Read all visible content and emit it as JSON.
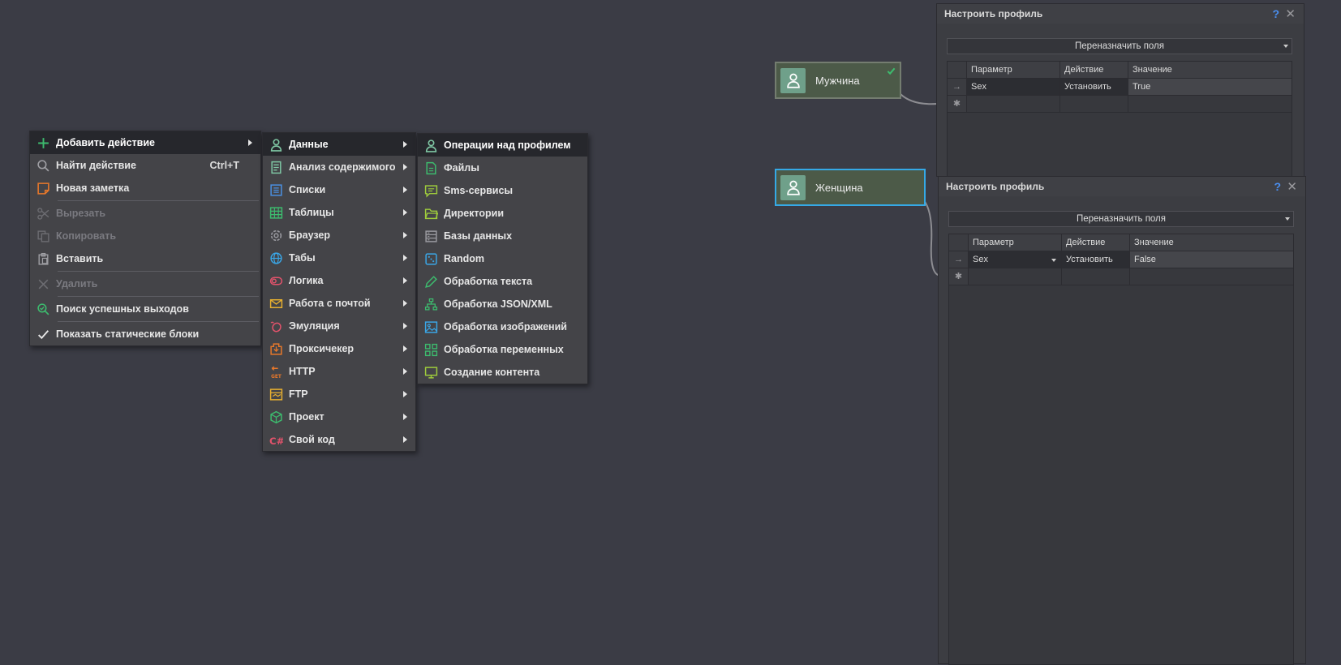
{
  "menu_main": {
    "items": [
      {
        "label": "Добавить действие",
        "icon": "plus-icon",
        "color": "#3dbb6e",
        "active": true,
        "arrow": true,
        "disabled": false
      },
      {
        "label": "Найти действие",
        "icon": "search-icon",
        "shortcut": "Ctrl+T",
        "disabled": false
      },
      {
        "label": "Новая заметка",
        "icon": "note-icon",
        "color": "#e8782a",
        "disabled": false
      },
      {
        "label": "Вырезать",
        "icon": "scissors-icon",
        "disabled": true
      },
      {
        "label": "Копировать",
        "icon": "copy-icon",
        "disabled": true
      },
      {
        "label": "Вставить",
        "icon": "paste-icon",
        "disabled": false
      },
      {
        "label": "Удалить",
        "icon": "close-icon",
        "disabled": true
      },
      {
        "label": "Поиск успешных выходов",
        "icon": "search-check-icon",
        "color": "#3dbb6e",
        "disabled": false
      },
      {
        "label": "Показать статические блоки",
        "icon": "check-icon",
        "disabled": false
      }
    ]
  },
  "menu_categories": {
    "items": [
      {
        "label": "Данные",
        "icon": "user-icon",
        "color": "#7fc7a4",
        "active": true
      },
      {
        "label": "Анализ содержимого",
        "icon": "document-analysis-icon",
        "color": "#7fc7a4"
      },
      {
        "label": "Списки",
        "icon": "list-icon",
        "color": "#4a90e2"
      },
      {
        "label": "Таблицы",
        "icon": "table-icon",
        "color": "#3dbb6e"
      },
      {
        "label": "Браузер",
        "icon": "gear-icon",
        "color": "#9a9aa0"
      },
      {
        "label": "Табы",
        "icon": "globe-icon",
        "color": "#3aa6e6"
      },
      {
        "label": "Логика",
        "icon": "toggle-icon",
        "color": "#e5536c"
      },
      {
        "label": "Работа с почтой",
        "icon": "mail-icon",
        "color": "#e8b030"
      },
      {
        "label": "Эмуляция",
        "icon": "mouse-icon",
        "color": "#e5536c"
      },
      {
        "label": "Проксичекер",
        "icon": "proxy-icon",
        "color": "#e8782a"
      },
      {
        "label": "HTTP",
        "icon": "http-get-icon",
        "color": "#e8782a"
      },
      {
        "label": "FTP",
        "icon": "ftp-icon",
        "color": "#e8b030"
      },
      {
        "label": "Проект",
        "icon": "cube-icon",
        "color": "#3dbb6e"
      },
      {
        "label": "Свой код",
        "icon": "csharp-icon",
        "color": "#e5536c"
      }
    ]
  },
  "menu_data": {
    "items": [
      {
        "label": "Операции над профилем",
        "icon": "user-icon",
        "color": "#7fc7a4",
        "active": true
      },
      {
        "label": "Файлы",
        "icon": "file-icon",
        "color": "#3dbb6e"
      },
      {
        "label": "Sms-сервисы",
        "icon": "chat-icon",
        "color": "#9ecb3c"
      },
      {
        "label": "Директории",
        "icon": "folder-icon",
        "color": "#9ecb3c"
      },
      {
        "label": "Базы данных",
        "icon": "database-icon",
        "color": "#9a9aa0"
      },
      {
        "label": "Random",
        "icon": "dice-icon",
        "color": "#3aa6e6"
      },
      {
        "label": "Обработка текста",
        "icon": "pencil-icon",
        "color": "#3dbb6e"
      },
      {
        "label": "Обработка JSON/XML",
        "icon": "hierarchy-icon",
        "color": "#3dbb6e"
      },
      {
        "label": "Обработка изображений",
        "icon": "image-icon",
        "color": "#3aa6e6"
      },
      {
        "label": "Обработка переменных",
        "icon": "grid-icon",
        "color": "#3dbb6e"
      },
      {
        "label": "Создание контента",
        "icon": "monitor-icon",
        "color": "#9ecb3c"
      }
    ]
  },
  "nodes": [
    {
      "label": "Мужчина",
      "icon": "user-icon",
      "checked": true,
      "selected": false
    },
    {
      "label": "Женщина",
      "icon": "user-icon",
      "checked": false,
      "selected": true
    }
  ],
  "panels": [
    {
      "title": "Настроить профиль",
      "help": "?",
      "close": "✕",
      "dropdown": "Переназначить поля",
      "columns": [
        "Параметр",
        "Действие",
        "Значение"
      ],
      "rows": [
        {
          "param": "Sex",
          "action": "Установить",
          "value": "True"
        }
      ]
    },
    {
      "title": "Настроить профиль",
      "help": "?",
      "close": "✕",
      "dropdown": "Переназначить поля",
      "columns": [
        "Параметр",
        "Действие",
        "Значение"
      ],
      "rows": [
        {
          "param": "Sex",
          "action": "Установить",
          "value": "False"
        }
      ]
    }
  ],
  "glyphs": {
    "row_arrow": "→",
    "new_row": "✱"
  }
}
